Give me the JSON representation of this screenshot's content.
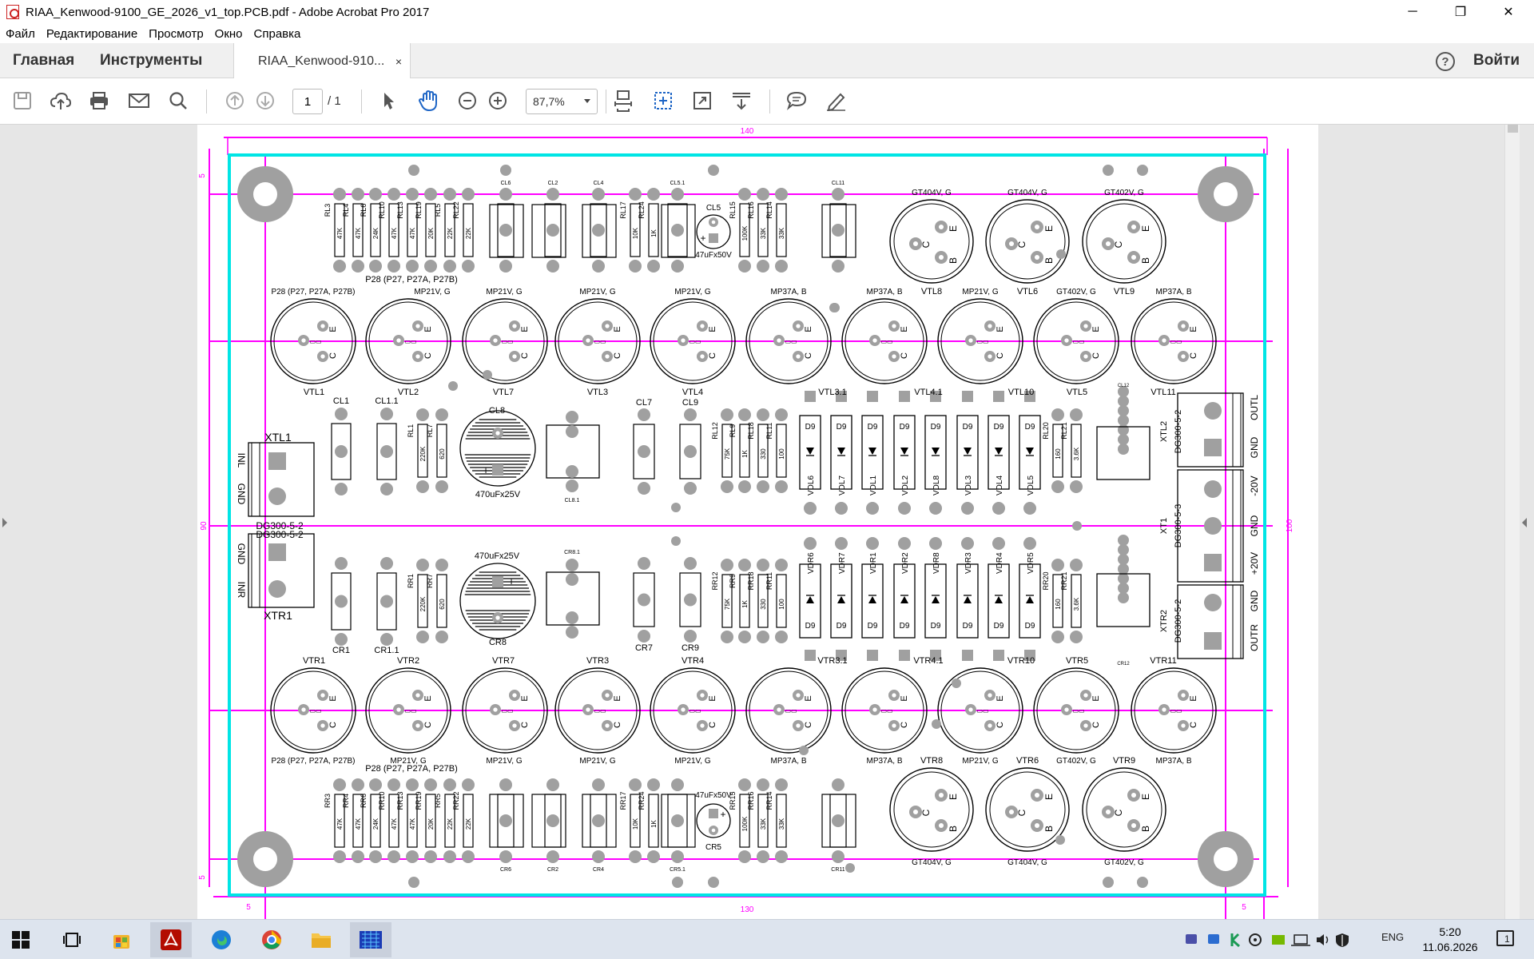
{
  "window": {
    "title": "RIAA_Kenwood-9100_GE_2026_v1_top.PCB.pdf - Adobe Acrobat Pro 2017",
    "minimize": "─",
    "restore": "❐",
    "close": "✕"
  },
  "menu": [
    "Файл",
    "Редактирование",
    "Просмотр",
    "Окно",
    "Справка"
  ],
  "tabs": {
    "home": "Главная",
    "tools": "Инструменты",
    "doc": "RIAA_Kenwood-910...",
    "doc_close": "×",
    "help": "?",
    "login": "Войти"
  },
  "toolbar": {
    "page_current": "1",
    "page_total": "/  1",
    "zoom": "87,7%"
  },
  "colors": {
    "accent": "#1f66c6",
    "board_outline": "#00e5e5",
    "dimension": "#ff00ff",
    "pad": "#a0a0a0",
    "silk": "#000000"
  },
  "pcb": {
    "dims": {
      "top": "140",
      "bottom": "130",
      "left": "90",
      "right": "100",
      "corner_tl": "5",
      "corner_bl": "5",
      "bl_small": "5",
      "br_small": "5"
    },
    "top_rl_labels": [
      "RL3",
      "RL4",
      "RL6",
      "RL10",
      "RL13",
      "RL19",
      "RL5",
      "RL22"
    ],
    "top_rl_values": [
      "47K",
      "47K",
      "24K",
      "47K",
      "47K",
      "20K",
      "22K",
      "22K"
    ],
    "top_rl2_labels": [
      "RL17",
      "RL24"
    ],
    "top_rl2_values": [
      "10K",
      "1K"
    ],
    "top_rl3_labels": [
      "RL15",
      "RL16",
      "RL14"
    ],
    "top_rl3_values": [
      "100K",
      "33K",
      "33K"
    ],
    "top_caps": [
      "CL6",
      "CL2",
      "CL4",
      "CL5.1",
      "CL11"
    ],
    "cl5": "CL5",
    "cl5_value": "47uFx50V",
    "p28_top": "P28 (P27, P27A, P27B)",
    "p28_left_top": "P28 (P27, P27A, P27B)",
    "top_big": [
      {
        "label": "GT404V, G",
        "ref": "VTL8"
      },
      {
        "label": "GT404V, G",
        "ref": "VTL6"
      },
      {
        "label": "GT402V, G",
        "ref": "VTL9"
      }
    ],
    "row2_types": [
      "MP21V, G",
      "MP21V, G",
      "MP21V, G",
      "MP37A, B",
      "MP37A, B",
      "MP21V, G",
      "GT402V, G",
      "MP37A, B"
    ],
    "row2_refs": [
      "VTL1",
      "VTL2",
      "VTL7",
      "VTL3",
      "VTL4",
      "VTL3.1",
      "VTL4.1",
      "VTL10",
      "VTL5",
      "VTL11"
    ],
    "mid_labels": {
      "cl1": "CL1",
      "cl11": "CL1.1",
      "cl8": "CL8",
      "cl7": "CL7",
      "cl9": "CL9",
      "cl8v": "470uFx25V",
      "xtl1": "XTL1",
      "inl": "INL",
      "gnd": "GND",
      "dg1": "DG300-5-2",
      "dg2": "DG300-5-2",
      "cr8": "CR8",
      "cr8v": "470uFx25V",
      "xtr1": "XTR1",
      "gnd2": "GND",
      "inr": "INR",
      "cr1": "CR1",
      "cr11": "CR1.1",
      "cr7": "CR7",
      "cr9": "CR9",
      "cl81": "CL8.1",
      "cr81": "CR8.1",
      "cl12": "CL12",
      "cr12": "CR12"
    },
    "mid_rl": [
      "RL1",
      "RL7",
      "RL12",
      "RL9",
      "RL18",
      "RL11"
    ],
    "mid_rl_values": [
      "220K",
      "620",
      "75K",
      "1K",
      "330",
      "100"
    ],
    "mid_rr": [
      "RR1",
      "RR7",
      "RR12",
      "RR9",
      "RR18",
      "RR11"
    ],
    "mid_rr_values": [
      "220K",
      "620",
      "75K",
      "1K",
      "330",
      "100"
    ],
    "diode": "D9",
    "vdl": [
      "VDL6",
      "VDL7",
      "VDL1",
      "VDL2",
      "VDL8",
      "VDL3",
      "VDL4",
      "VDL5"
    ],
    "vdr": [
      "VDR6",
      "VDR7",
      "VDR1",
      "VDR2",
      "VDR8",
      "VDR3",
      "VDR4",
      "VDR5"
    ],
    "rl_right": [
      "RL20",
      "RL21"
    ],
    "rl_right_values": [
      "160",
      "3.6K"
    ],
    "rr_right": [
      "RR20",
      "RR21"
    ],
    "rr_right_values": [
      "160",
      "3.6K"
    ],
    "right_conn": {
      "xtl2": "XTL2",
      "xtl2_dg": "DG300-5-2",
      "outl": "OUTL",
      "gndl": "GND",
      "xt1": "XT1",
      "xt1_dg": "DG300-5-3",
      "m20": "-20V",
      "gnd": "GND",
      "p20": "+20V",
      "xtr2": "XTR2",
      "xtr2_dg": "DG300-5-2",
      "gndr": "GND",
      "outr": "OUTR"
    },
    "row4_refs": [
      "VTR1",
      "VTR2",
      "VTR7",
      "VTR3",
      "VTR4",
      "VTR3.1",
      "VTR4.1",
      "VTR10",
      "VTR5",
      "VTR11"
    ],
    "row4_types": [
      "MP21V, G",
      "MP21V, G",
      "MP21V, G",
      "MP37A, B",
      "MP37A, B",
      "MP21V, G",
      "GT402V, G",
      "MP37A, B"
    ],
    "p28_left_bottom": "P28 (P27, P27A, P27B)",
    "p28_bottom": "P28 (P27, P27A, P27B)",
    "bot_rr_labels": [
      "RR3",
      "RR4",
      "RR6",
      "RR10",
      "RR13",
      "RR19",
      "RR5",
      "RR22"
    ],
    "bot_rr_values": [
      "47K",
      "47K",
      "24K",
      "47K",
      "47K",
      "20K",
      "22K",
      "22K"
    ],
    "bot_rr2_labels": [
      "RR17",
      "RR24"
    ],
    "bot_rr2_values": [
      "10K",
      "1K"
    ],
    "bot_rr3_labels": [
      "RR15",
      "RR16",
      "RR14"
    ],
    "bot_rr3_values": [
      "100K",
      "33K",
      "33K"
    ],
    "bot_caps": [
      "CR6",
      "CR2",
      "CR4",
      "CR5.1",
      "CR11"
    ],
    "cr5": "CR5",
    "cr5_value": "47uFx50V",
    "bot_big": [
      {
        "label": "GT404V, G",
        "ref": "VTR8"
      },
      {
        "label": "GT404V, G",
        "ref": "VTR6"
      },
      {
        "label": "GT402V, G",
        "ref": "VTR9"
      }
    ],
    "pin_e": "E",
    "pin_c": "C",
    "pin_b": "B"
  },
  "taskbar": {
    "lang": "ENG",
    "time": "5:20",
    "date": "11.06.2026",
    "notif": "1"
  }
}
